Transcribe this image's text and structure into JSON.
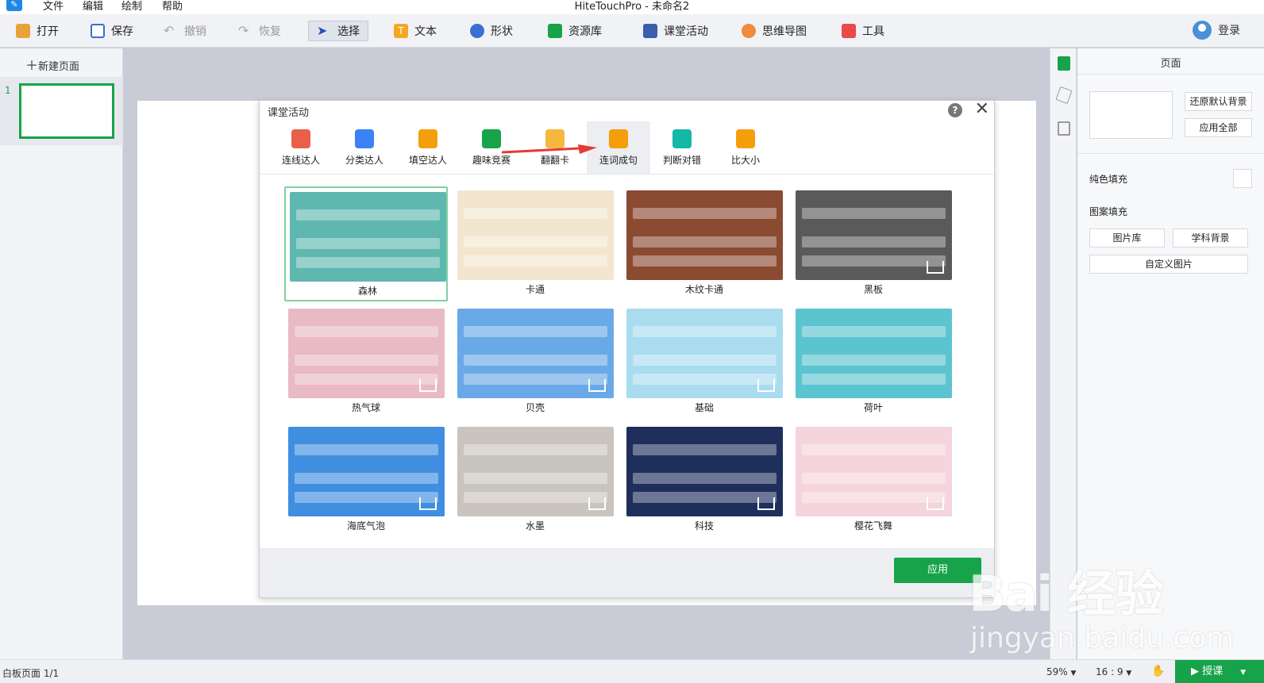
{
  "titlebar": {
    "menus": [
      "文件",
      "编辑",
      "绘制",
      "帮助"
    ],
    "window_title": "HiteTouchPro - 未命名2"
  },
  "toolbar": {
    "open": "打开",
    "save": "保存",
    "undo": "撤销",
    "redo": "恢复",
    "select": "选择",
    "text": "文本",
    "shape": "形状",
    "resources": "资源库",
    "classroom": "课堂活动",
    "mindmap": "思维导图",
    "tools": "工具",
    "login": "登录"
  },
  "left_panel": {
    "new_page": "新建页面",
    "page_number": "1"
  },
  "right_panel": {
    "title": "页面",
    "restore_bg": "还原默认背景",
    "apply_all": "应用全部",
    "solid_fill": "纯色填充",
    "pattern_fill": "图案填充",
    "gallery": "图片库",
    "subject_bg": "学科背景",
    "custom_image": "自定义图片"
  },
  "statusbar": {
    "page_info": "白板页面 1/1",
    "zoom": "59%",
    "ratio": "16 : 9",
    "teach": "授课"
  },
  "dialog": {
    "title": "课堂活动",
    "help": "?",
    "close": "✕",
    "tabs": [
      {
        "label": "连线达人",
        "color": "#e8604c"
      },
      {
        "label": "分类达人",
        "color": "#3b82f6"
      },
      {
        "label": "填空达人",
        "color": "#f59e0b"
      },
      {
        "label": "趣味竞赛",
        "color": "#16a34a"
      },
      {
        "label": "翻翻卡",
        "color": "#f5b83d"
      },
      {
        "label": "连词成句",
        "color": "#f59e0b"
      },
      {
        "label": "判断对错",
        "color": "#14b8a6"
      },
      {
        "label": "比大小",
        "color": "#f59e0b"
      }
    ],
    "active_tab": "连词成句",
    "templates": [
      {
        "label": "森林",
        "color": "#5fb8b0",
        "selected": true,
        "download": false
      },
      {
        "label": "卡通",
        "color": "#f3e6cf",
        "selected": false,
        "download": false
      },
      {
        "label": "木纹卡通",
        "color": "#8b4a32",
        "selected": false,
        "download": false
      },
      {
        "label": "黑板",
        "color": "#5a5a5a",
        "selected": false,
        "download": true
      },
      {
        "label": "热气球",
        "color": "#e9b9c4",
        "selected": false,
        "download": true
      },
      {
        "label": "贝壳",
        "color": "#6aa9e8",
        "selected": false,
        "download": true
      },
      {
        "label": "基础",
        "color": "#a9dcef",
        "selected": false,
        "download": true
      },
      {
        "label": "荷叶",
        "color": "#5cc4cf",
        "selected": false,
        "download": false
      },
      {
        "label": "海底气泡",
        "color": "#3f8ee0",
        "selected": false,
        "download": true
      },
      {
        "label": "水墨",
        "color": "#c9c4bd",
        "selected": false,
        "download": true
      },
      {
        "label": "科技",
        "color": "#1f2f5c",
        "selected": false,
        "download": true
      },
      {
        "label": "樱花飞舞",
        "color": "#f5d4dc",
        "selected": false,
        "download": true
      }
    ],
    "apply": "应用"
  },
  "watermark": {
    "main": "Bai 经验",
    "sub": "jingyan.baidu.com"
  }
}
